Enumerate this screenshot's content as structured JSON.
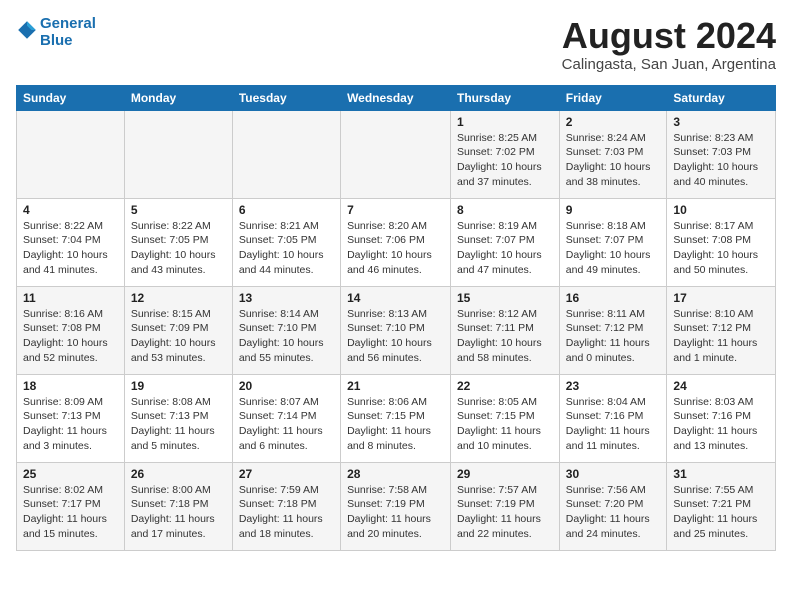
{
  "header": {
    "logo_line1": "General",
    "logo_line2": "Blue",
    "month": "August 2024",
    "location": "Calingasta, San Juan, Argentina"
  },
  "weekdays": [
    "Sunday",
    "Monday",
    "Tuesday",
    "Wednesday",
    "Thursday",
    "Friday",
    "Saturday"
  ],
  "weeks": [
    [
      {
        "day": "",
        "sunrise": "",
        "sunset": "",
        "daylight": ""
      },
      {
        "day": "",
        "sunrise": "",
        "sunset": "",
        "daylight": ""
      },
      {
        "day": "",
        "sunrise": "",
        "sunset": "",
        "daylight": ""
      },
      {
        "day": "",
        "sunrise": "",
        "sunset": "",
        "daylight": ""
      },
      {
        "day": "1",
        "sunrise": "Sunrise: 8:25 AM",
        "sunset": "Sunset: 7:02 PM",
        "daylight": "Daylight: 10 hours and 37 minutes."
      },
      {
        "day": "2",
        "sunrise": "Sunrise: 8:24 AM",
        "sunset": "Sunset: 7:03 PM",
        "daylight": "Daylight: 10 hours and 38 minutes."
      },
      {
        "day": "3",
        "sunrise": "Sunrise: 8:23 AM",
        "sunset": "Sunset: 7:03 PM",
        "daylight": "Daylight: 10 hours and 40 minutes."
      }
    ],
    [
      {
        "day": "4",
        "sunrise": "Sunrise: 8:22 AM",
        "sunset": "Sunset: 7:04 PM",
        "daylight": "Daylight: 10 hours and 41 minutes."
      },
      {
        "day": "5",
        "sunrise": "Sunrise: 8:22 AM",
        "sunset": "Sunset: 7:05 PM",
        "daylight": "Daylight: 10 hours and 43 minutes."
      },
      {
        "day": "6",
        "sunrise": "Sunrise: 8:21 AM",
        "sunset": "Sunset: 7:05 PM",
        "daylight": "Daylight: 10 hours and 44 minutes."
      },
      {
        "day": "7",
        "sunrise": "Sunrise: 8:20 AM",
        "sunset": "Sunset: 7:06 PM",
        "daylight": "Daylight: 10 hours and 46 minutes."
      },
      {
        "day": "8",
        "sunrise": "Sunrise: 8:19 AM",
        "sunset": "Sunset: 7:07 PM",
        "daylight": "Daylight: 10 hours and 47 minutes."
      },
      {
        "day": "9",
        "sunrise": "Sunrise: 8:18 AM",
        "sunset": "Sunset: 7:07 PM",
        "daylight": "Daylight: 10 hours and 49 minutes."
      },
      {
        "day": "10",
        "sunrise": "Sunrise: 8:17 AM",
        "sunset": "Sunset: 7:08 PM",
        "daylight": "Daylight: 10 hours and 50 minutes."
      }
    ],
    [
      {
        "day": "11",
        "sunrise": "Sunrise: 8:16 AM",
        "sunset": "Sunset: 7:08 PM",
        "daylight": "Daylight: 10 hours and 52 minutes."
      },
      {
        "day": "12",
        "sunrise": "Sunrise: 8:15 AM",
        "sunset": "Sunset: 7:09 PM",
        "daylight": "Daylight: 10 hours and 53 minutes."
      },
      {
        "day": "13",
        "sunrise": "Sunrise: 8:14 AM",
        "sunset": "Sunset: 7:10 PM",
        "daylight": "Daylight: 10 hours and 55 minutes."
      },
      {
        "day": "14",
        "sunrise": "Sunrise: 8:13 AM",
        "sunset": "Sunset: 7:10 PM",
        "daylight": "Daylight: 10 hours and 56 minutes."
      },
      {
        "day": "15",
        "sunrise": "Sunrise: 8:12 AM",
        "sunset": "Sunset: 7:11 PM",
        "daylight": "Daylight: 10 hours and 58 minutes."
      },
      {
        "day": "16",
        "sunrise": "Sunrise: 8:11 AM",
        "sunset": "Sunset: 7:12 PM",
        "daylight": "Daylight: 11 hours and 0 minutes."
      },
      {
        "day": "17",
        "sunrise": "Sunrise: 8:10 AM",
        "sunset": "Sunset: 7:12 PM",
        "daylight": "Daylight: 11 hours and 1 minute."
      }
    ],
    [
      {
        "day": "18",
        "sunrise": "Sunrise: 8:09 AM",
        "sunset": "Sunset: 7:13 PM",
        "daylight": "Daylight: 11 hours and 3 minutes."
      },
      {
        "day": "19",
        "sunrise": "Sunrise: 8:08 AM",
        "sunset": "Sunset: 7:13 PM",
        "daylight": "Daylight: 11 hours and 5 minutes."
      },
      {
        "day": "20",
        "sunrise": "Sunrise: 8:07 AM",
        "sunset": "Sunset: 7:14 PM",
        "daylight": "Daylight: 11 hours and 6 minutes."
      },
      {
        "day": "21",
        "sunrise": "Sunrise: 8:06 AM",
        "sunset": "Sunset: 7:15 PM",
        "daylight": "Daylight: 11 hours and 8 minutes."
      },
      {
        "day": "22",
        "sunrise": "Sunrise: 8:05 AM",
        "sunset": "Sunset: 7:15 PM",
        "daylight": "Daylight: 11 hours and 10 minutes."
      },
      {
        "day": "23",
        "sunrise": "Sunrise: 8:04 AM",
        "sunset": "Sunset: 7:16 PM",
        "daylight": "Daylight: 11 hours and 11 minutes."
      },
      {
        "day": "24",
        "sunrise": "Sunrise: 8:03 AM",
        "sunset": "Sunset: 7:16 PM",
        "daylight": "Daylight: 11 hours and 13 minutes."
      }
    ],
    [
      {
        "day": "25",
        "sunrise": "Sunrise: 8:02 AM",
        "sunset": "Sunset: 7:17 PM",
        "daylight": "Daylight: 11 hours and 15 minutes."
      },
      {
        "day": "26",
        "sunrise": "Sunrise: 8:00 AM",
        "sunset": "Sunset: 7:18 PM",
        "daylight": "Daylight: 11 hours and 17 minutes."
      },
      {
        "day": "27",
        "sunrise": "Sunrise: 7:59 AM",
        "sunset": "Sunset: 7:18 PM",
        "daylight": "Daylight: 11 hours and 18 minutes."
      },
      {
        "day": "28",
        "sunrise": "Sunrise: 7:58 AM",
        "sunset": "Sunset: 7:19 PM",
        "daylight": "Daylight: 11 hours and 20 minutes."
      },
      {
        "day": "29",
        "sunrise": "Sunrise: 7:57 AM",
        "sunset": "Sunset: 7:19 PM",
        "daylight": "Daylight: 11 hours and 22 minutes."
      },
      {
        "day": "30",
        "sunrise": "Sunrise: 7:56 AM",
        "sunset": "Sunset: 7:20 PM",
        "daylight": "Daylight: 11 hours and 24 minutes."
      },
      {
        "day": "31",
        "sunrise": "Sunrise: 7:55 AM",
        "sunset": "Sunset: 7:21 PM",
        "daylight": "Daylight: 11 hours and 25 minutes."
      }
    ]
  ]
}
